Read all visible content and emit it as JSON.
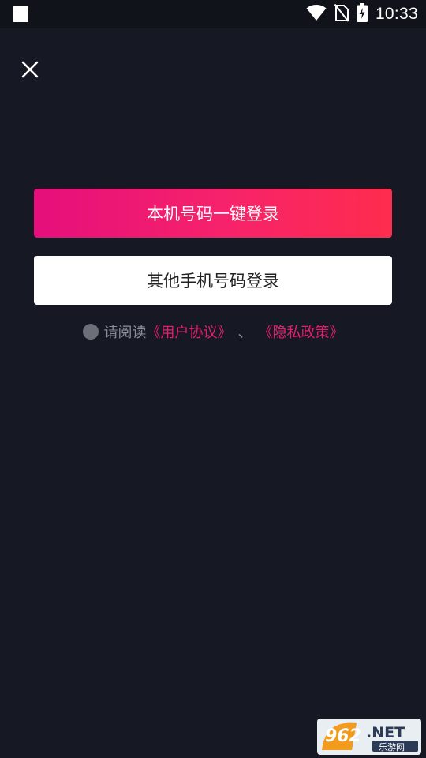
{
  "status_bar": {
    "time": "10:33"
  },
  "buttons": {
    "one_click_login": "本机号码一键登录",
    "other_phone_login": "其他手机号码登录"
  },
  "agreement": {
    "prefix": "请阅读",
    "user_agreement": "《用户协议》",
    "separator": "、",
    "privacy_policy": "《隐私政策》"
  },
  "watermark": {
    "brand": "962.NET",
    "sub": "乐游网"
  },
  "colors": {
    "background": "#161824",
    "primary_gradient_start": "#e50f7b",
    "primary_gradient_end": "#fe2c4d",
    "link": "#e3206f"
  }
}
